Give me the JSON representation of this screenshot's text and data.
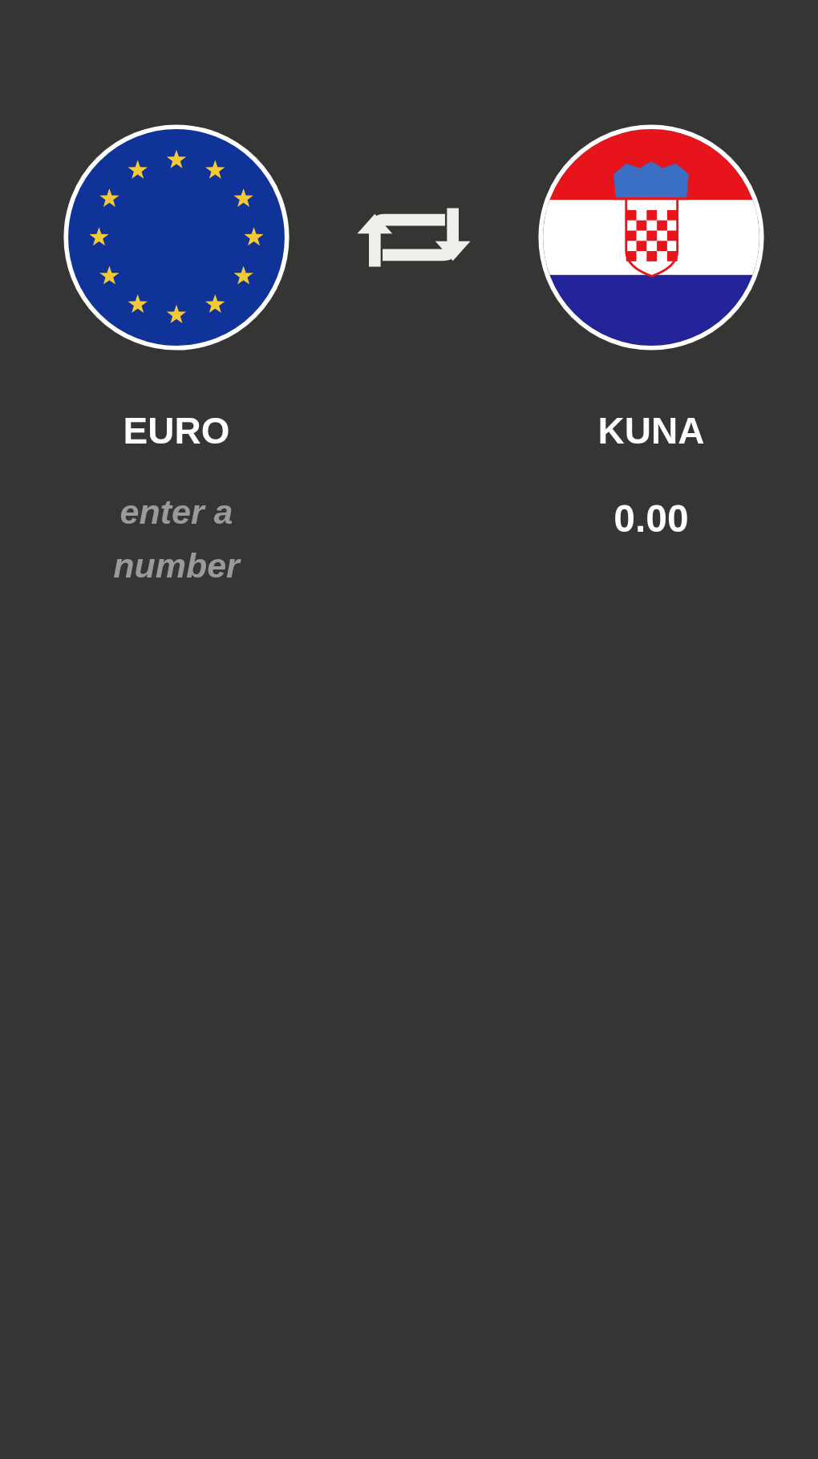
{
  "from": {
    "currency": "EURO",
    "placeholder": "enter a number"
  },
  "to": {
    "currency": "KUNA",
    "value": "0.00"
  }
}
